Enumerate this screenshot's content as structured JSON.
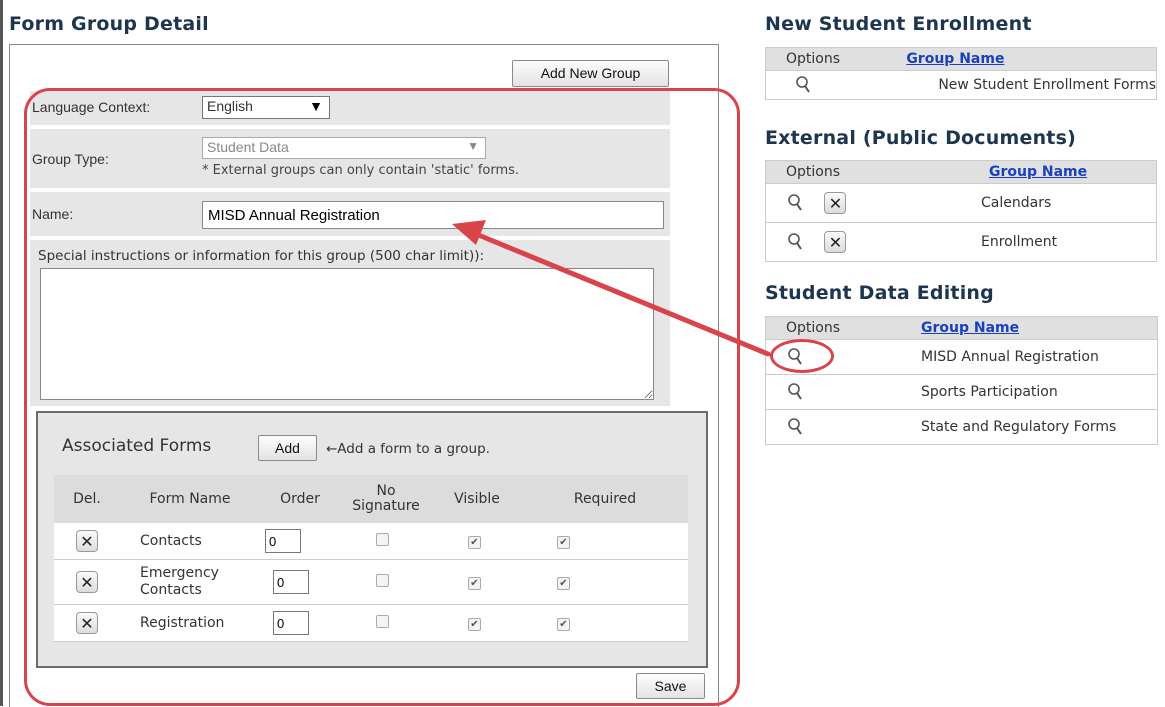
{
  "left": {
    "title": "Form Group Detail",
    "add_new_group_label": "Add New Group",
    "language_label": "Language Context:",
    "language_value": "English",
    "group_type_label": "Group Type:",
    "group_type_value": "Student Data",
    "group_type_note": "* External groups can only contain 'static' forms.",
    "name_label": "Name:",
    "name_value": "MISD Annual Registration",
    "instructions_label": "Special instructions or information for this group (500 char limit)):",
    "assoc": {
      "title": "Associated Forms",
      "add_label": "Add",
      "hint": "←Add a form to a group.",
      "headers": {
        "del": "Del.",
        "form_name": "Form Name",
        "order": "Order",
        "no_sig": "No Signature",
        "visible": "Visible",
        "required": "Required"
      },
      "rows": [
        {
          "name": "Contacts",
          "order": "0",
          "no_signature": false,
          "visible": true,
          "required": true
        },
        {
          "name": "Emergency Contacts",
          "order": "0",
          "no_signature": false,
          "visible": true,
          "required": true
        },
        {
          "name": "Registration",
          "order": "0",
          "no_signature": false,
          "visible": true,
          "required": true
        }
      ]
    },
    "save_label": "Save"
  },
  "right": {
    "nse": {
      "title": "New Student Enrollment",
      "col_options": "Options",
      "col_group": "Group Name",
      "rows": [
        {
          "name": "New Student Enrollment Forms"
        }
      ]
    },
    "ext": {
      "title": "External (Public Documents)",
      "col_options": "Options",
      "col_group": "Group Name",
      "rows": [
        {
          "name": "Calendars"
        },
        {
          "name": "Enrollment"
        }
      ]
    },
    "sde": {
      "title": "Student Data Editing",
      "col_options": "Options",
      "col_group": "Group Name",
      "rows": [
        {
          "name": "MISD Annual Registration"
        },
        {
          "name": "Sports Participation"
        },
        {
          "name": "State and Regulatory Forms"
        }
      ]
    }
  },
  "colors": {
    "annotation": "#d8444a",
    "link": "#1a3fbf",
    "heading": "#1e3550"
  },
  "icons": {
    "view": "magnifier-icon",
    "delete": "x-icon",
    "checkbox": "check-icon",
    "dropdown": "triangle-down-icon"
  }
}
